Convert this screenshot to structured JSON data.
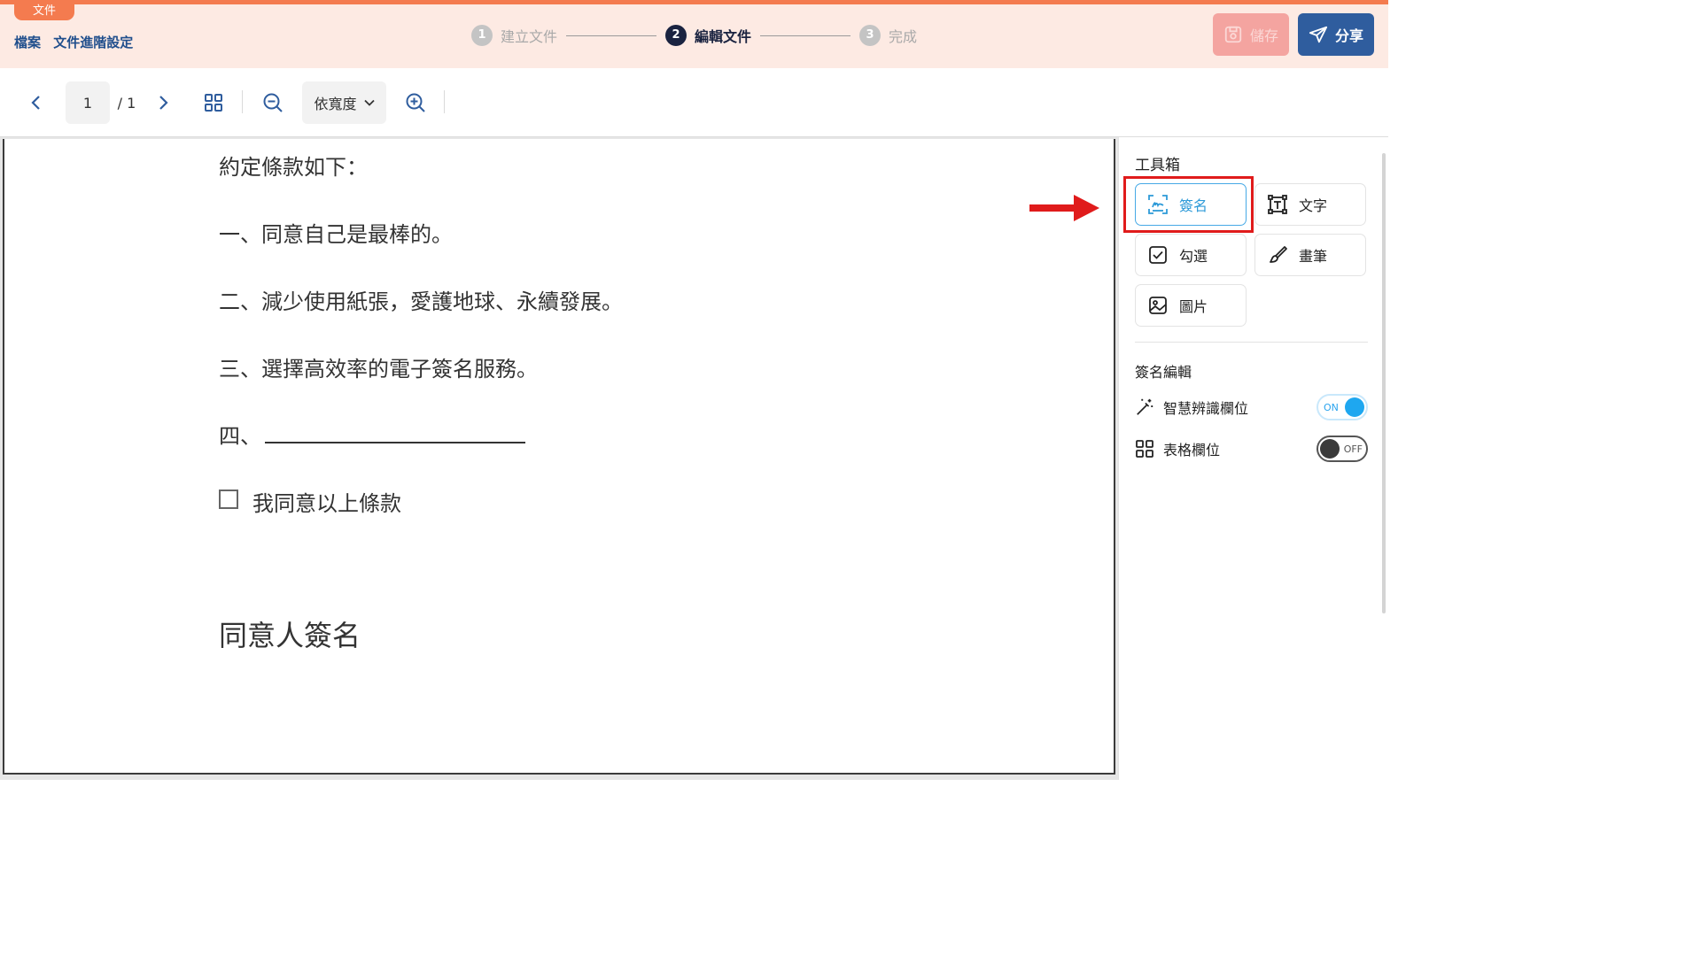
{
  "header": {
    "doc_tab": "文件",
    "breadcrumb": [
      "檔案",
      "文件進階設定"
    ],
    "steps": [
      {
        "num": "1",
        "label": "建立文件"
      },
      {
        "num": "2",
        "label": "編輯文件"
      },
      {
        "num": "3",
        "label": "完成"
      }
    ],
    "active_step": 2,
    "save_label": "儲存",
    "share_label": "分享"
  },
  "toolbar": {
    "current_page": "1",
    "total_pages": "/ 1",
    "zoom_mode": "依寬度"
  },
  "document": {
    "lines": [
      "約定條款如下：",
      "一、同意自己是最棒的。",
      "二、減少使用紙張，愛護地球、永續發展。",
      "三、選擇高效率的電子簽名服務。",
      "四、"
    ],
    "checkbox_label": "我同意以上條款",
    "signature_heading": "同意人簽名"
  },
  "panel": {
    "toolbox_title": "工具箱",
    "tools": [
      {
        "label": "簽名",
        "icon": "signature-icon",
        "selected": true
      },
      {
        "label": "文字",
        "icon": "text-box-icon",
        "selected": false
      },
      {
        "label": "勾選",
        "icon": "checkbox-icon",
        "selected": false
      },
      {
        "label": "畫筆",
        "icon": "brush-icon",
        "selected": false
      },
      {
        "label": "圖片",
        "icon": "image-icon",
        "selected": false
      }
    ],
    "sign_edit_title": "簽名編輯",
    "settings": [
      {
        "label": "智慧辨識欄位",
        "icon": "magic-wand-icon",
        "toggle": "ON"
      },
      {
        "label": "表格欄位",
        "icon": "grid-icon",
        "toggle": "OFF"
      }
    ]
  },
  "colors": {
    "accent_orange": "#f47b4f",
    "header_bg": "#fdeae3",
    "primary_blue": "#2f5d9e",
    "selected_tool": "#2d9ad8",
    "highlight_red": "#e01b1b"
  }
}
